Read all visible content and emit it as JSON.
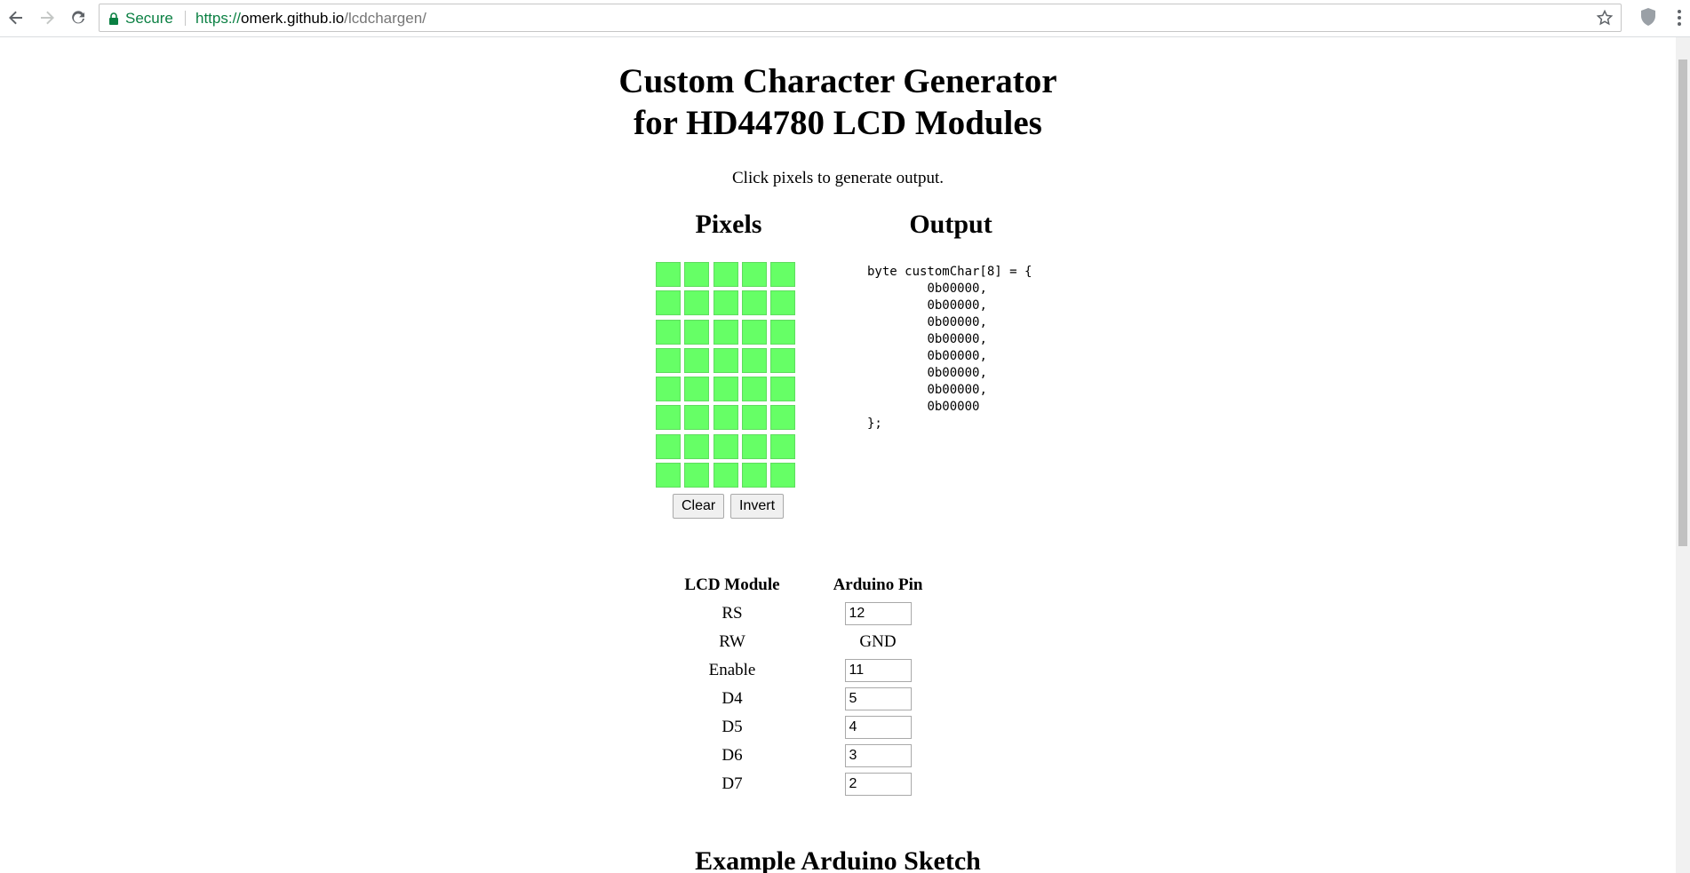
{
  "browser": {
    "secure_label": "Secure",
    "url_scheme": "https://",
    "url_host": "omerk.github.io",
    "url_path": "/lcdchargen/"
  },
  "page": {
    "title_line1": "Custom Character Generator",
    "title_line2": "for HD44780 LCD Modules",
    "subtitle": "Click pixels to generate output.",
    "pixels_heading": "Pixels",
    "output_heading": "Output",
    "pixel_color": "#66ff66",
    "pixel_rows": 8,
    "pixel_cols": 5,
    "buttons": {
      "clear": "Clear",
      "invert": "Invert"
    },
    "output": {
      "declaration": "byte customChar[8] = {",
      "rows": [
        "0b00000,",
        "0b00000,",
        "0b00000,",
        "0b00000,",
        "0b00000,",
        "0b00000,",
        "0b00000,",
        "0b00000"
      ],
      "closing": "};"
    },
    "pins": {
      "header_module": "LCD Module",
      "header_pin": "Arduino Pin",
      "rows": [
        {
          "module": "RS",
          "value": "12",
          "editable": true
        },
        {
          "module": "RW",
          "value": "GND",
          "editable": false
        },
        {
          "module": "Enable",
          "value": "11",
          "editable": true
        },
        {
          "module": "D4",
          "value": "5",
          "editable": true
        },
        {
          "module": "D5",
          "value": "4",
          "editable": true
        },
        {
          "module": "D6",
          "value": "3",
          "editable": true
        },
        {
          "module": "D7",
          "value": "2",
          "editable": true
        }
      ]
    },
    "sketch_heading": "Example Arduino Sketch"
  }
}
